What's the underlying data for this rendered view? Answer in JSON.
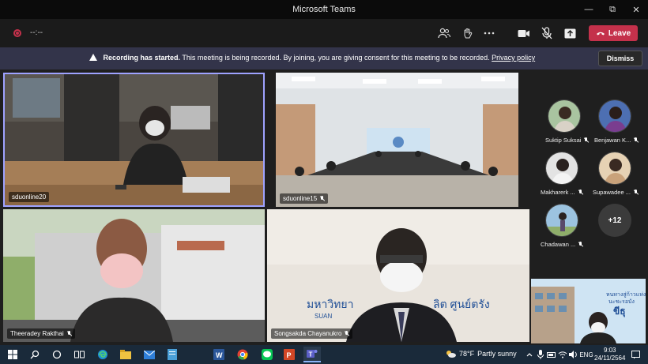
{
  "window": {
    "title": "Microsoft Teams",
    "controls": [
      "minimize",
      "restore",
      "close"
    ]
  },
  "toolbar": {
    "timer": "--:--",
    "leave_label": "Leave",
    "icons": [
      "people-icon",
      "raise-hand-icon",
      "more-icon",
      "camera-icon",
      "mic-off-icon",
      "share-icon"
    ]
  },
  "banner": {
    "bold": "Recording has started.",
    "text": "This meeting is being recorded. By joining, you are giving consent for this meeting to be recorded.",
    "link": "Privacy policy",
    "dismiss_label": "Dismiss"
  },
  "tiles": [
    {
      "name": "sduonline20",
      "muted": false
    },
    {
      "name": "sduonline15",
      "muted": true
    },
    {
      "name": "Theeradey Rakthai",
      "muted": true
    },
    {
      "name": "Songsakda Chayanukro",
      "muted": true
    }
  ],
  "banner_text": {
    "thai_line1": "มหาวิทยา",
    "thai_line2": "ลิต ศูนย์ตรัง",
    "en": "SUAN"
  },
  "self_view_text": {
    "line1": "หนทางสู่ก้าวแห่ง",
    "line2": "นะชะรอบัง",
    "brand": "ขีธุ"
  },
  "roster": [
    {
      "name": "Suktip Suksai"
    },
    {
      "name": "Benjawan K..."
    },
    {
      "name": "Makharerk ..."
    },
    {
      "name": "Supawadee ..."
    },
    {
      "name": "Chadawan ..."
    }
  ],
  "overflow_count": "+12",
  "taskbar": {
    "temperature": "78°F",
    "weather": "Partly sunny",
    "time": "9:03",
    "date": "24/11/2564",
    "apps": [
      "windows-icon",
      "search-icon",
      "cortana-icon",
      "taskview-icon",
      "edge-icon",
      "explorer-icon",
      "mail-icon",
      "notes-icon",
      "word-icon",
      "chrome-icon",
      "line-icon",
      "powerpoint-icon",
      "teams-icon"
    ]
  },
  "colors": {
    "leave": "#c4314b",
    "banner": "#33344a",
    "active_border": "#9ea2ff"
  }
}
